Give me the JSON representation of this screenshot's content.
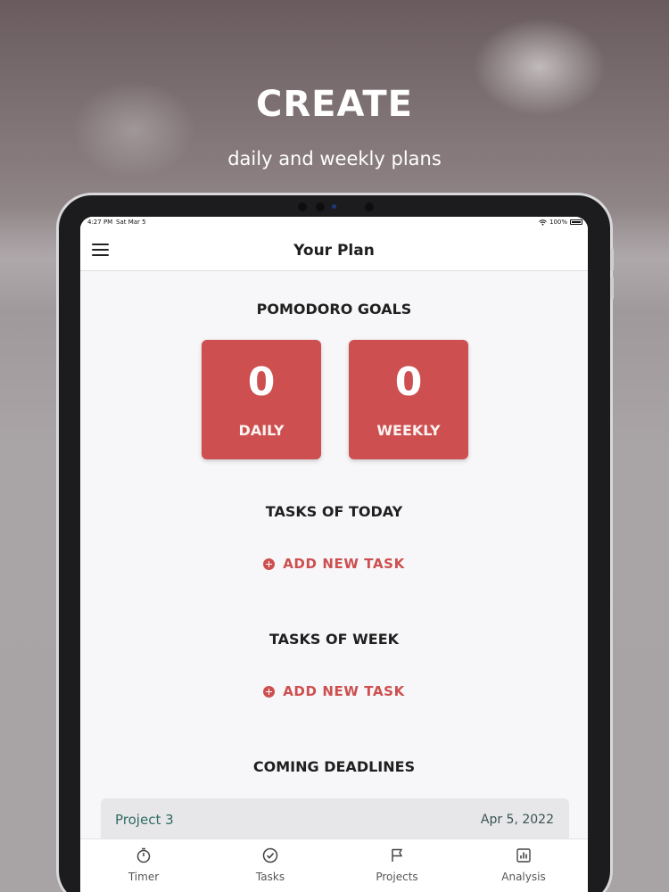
{
  "hero": {
    "title": "CREATE",
    "subtitle": "daily and weekly plans"
  },
  "status_bar": {
    "time": "4:27 PM",
    "date": "Sat Mar 5",
    "battery": "100%"
  },
  "nav": {
    "title": "Your Plan",
    "menu_icon": "hamburger-menu-icon"
  },
  "pomodoro_goals": {
    "heading": "POMODORO GOALS",
    "daily": {
      "value": "0",
      "label": "DAILY"
    },
    "weekly": {
      "value": "0",
      "label": "WEEKLY"
    }
  },
  "tasks_today": {
    "heading": "TASKS OF TODAY",
    "add_label": "ADD NEW TASK"
  },
  "tasks_week": {
    "heading": "TASKS OF WEEK",
    "add_label": "ADD NEW TASK"
  },
  "coming_deadlines": {
    "heading": "COMING DEADLINES",
    "items": [
      {
        "name": "Project 3",
        "date": "Apr 5, 2022"
      }
    ]
  },
  "tabs": [
    {
      "label": "Timer",
      "icon": "stopwatch-icon"
    },
    {
      "label": "Tasks",
      "icon": "check-circle-icon"
    },
    {
      "label": "Projects",
      "icon": "flag-icon"
    },
    {
      "label": "Analysis",
      "icon": "bar-chart-icon"
    }
  ],
  "colors": {
    "accent": "#cd4f4f",
    "deadline_text": "#2f6b62"
  }
}
